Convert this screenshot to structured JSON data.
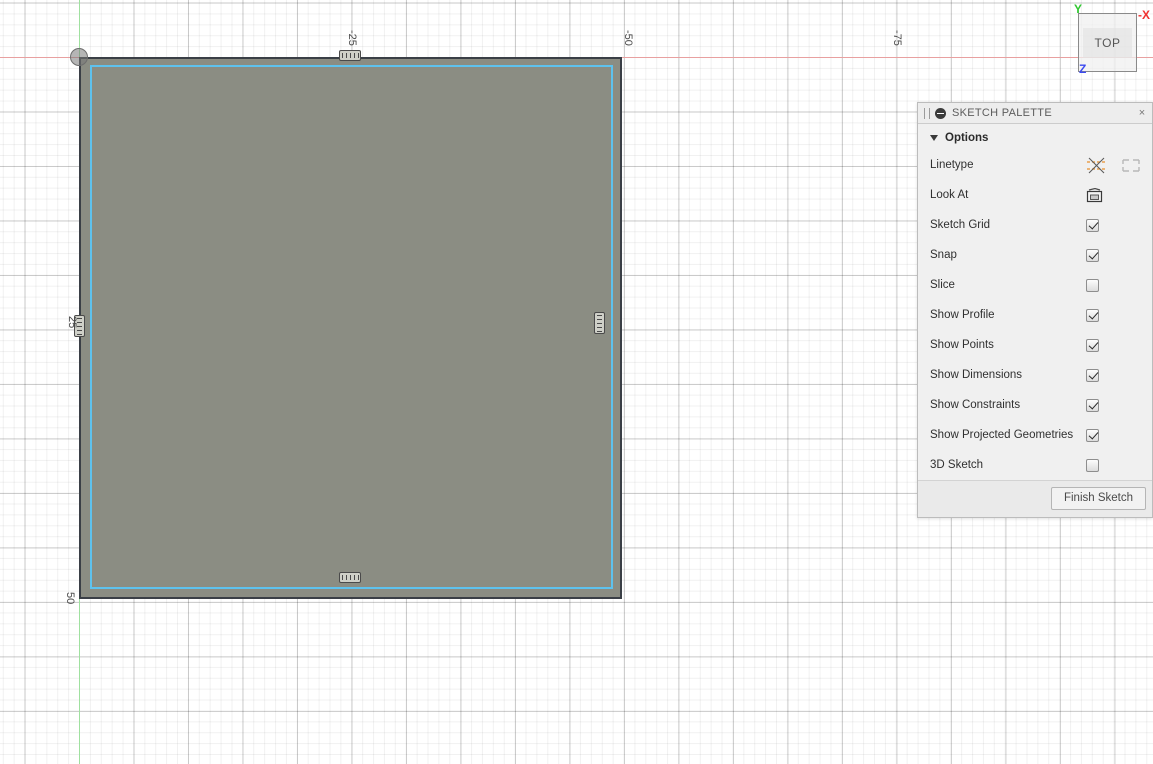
{
  "app": {
    "mode": "sketch-edit"
  },
  "canvas": {
    "grid_enabled": true,
    "axis_x_color": "#e8a0a0",
    "axis_y_color": "#9fe09f",
    "origin_label": "origin",
    "sketch": {
      "fill_color": "#8b8d83",
      "edge_color": "#3a3f46",
      "profile_color": "#5ec2ee"
    },
    "ruler_ticks": [
      {
        "label": "-25",
        "axis": "x"
      },
      {
        "label": "-50",
        "axis": "x"
      },
      {
        "label": "-75",
        "axis": "x"
      },
      {
        "label": "25",
        "axis": "y"
      },
      {
        "label": "50",
        "axis": "y"
      }
    ],
    "constraints": [
      {
        "name": "horizontal",
        "position": "top"
      },
      {
        "name": "horizontal",
        "position": "bottom"
      },
      {
        "name": "vertical",
        "position": "right"
      },
      {
        "name": "vertical",
        "position": "left"
      }
    ]
  },
  "viewcube": {
    "face_label": "TOP",
    "axis_labels": {
      "y": {
        "text": "Y",
        "color": "#2fc72f"
      },
      "nx": {
        "text": "-X",
        "color": "#f0312f"
      },
      "z": {
        "text": "Z",
        "color": "#3b49f0"
      }
    }
  },
  "sketch_palette": {
    "title": "SKETCH PALETTE",
    "close_label": "×",
    "section_options_label": "Options",
    "options": [
      {
        "label": "Linetype",
        "control": "icons",
        "checked": null
      },
      {
        "label": "Look At",
        "control": "icon",
        "checked": null
      },
      {
        "label": "Sketch Grid",
        "control": "checkbox",
        "checked": true
      },
      {
        "label": "Snap",
        "control": "checkbox",
        "checked": true
      },
      {
        "label": "Slice",
        "control": "checkbox",
        "checked": false
      },
      {
        "label": "Show Profile",
        "control": "checkbox",
        "checked": true
      },
      {
        "label": "Show Points",
        "control": "checkbox",
        "checked": true
      },
      {
        "label": "Show Dimensions",
        "control": "checkbox",
        "checked": true
      },
      {
        "label": "Show Constraints",
        "control": "checkbox",
        "checked": true
      },
      {
        "label": "Show Projected Geometries",
        "control": "checkbox",
        "checked": true
      },
      {
        "label": "3D Sketch",
        "control": "checkbox",
        "checked": false
      }
    ],
    "finish_button_label": "Finish Sketch"
  }
}
